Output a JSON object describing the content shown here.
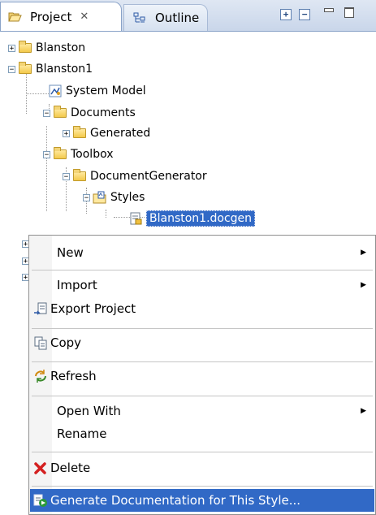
{
  "tabs": {
    "project": {
      "label": "Project",
      "close": "✕"
    },
    "outline": {
      "label": "Outline"
    }
  },
  "tree": {
    "items": [
      {
        "label": "Blanston",
        "toggle": "+"
      },
      {
        "label": "Blanston1",
        "toggle": "−"
      },
      {
        "label": "System Model"
      },
      {
        "label": "Documents",
        "toggle": "−"
      },
      {
        "label": "Generated",
        "toggle": "+"
      },
      {
        "label": "Toolbox",
        "toggle": "−"
      },
      {
        "label": "DocumentGenerator",
        "toggle": "−"
      },
      {
        "label": "Styles",
        "toggle": "−"
      },
      {
        "label": "Blanston1.docgen"
      }
    ]
  },
  "menu": {
    "new": "New",
    "import": "Import",
    "export": "Export Project",
    "copy": "Copy",
    "refresh": "Refresh",
    "open_with": "Open With",
    "rename": "Rename",
    "delete": "Delete",
    "generate": "Generate Documentation for This Style..."
  }
}
